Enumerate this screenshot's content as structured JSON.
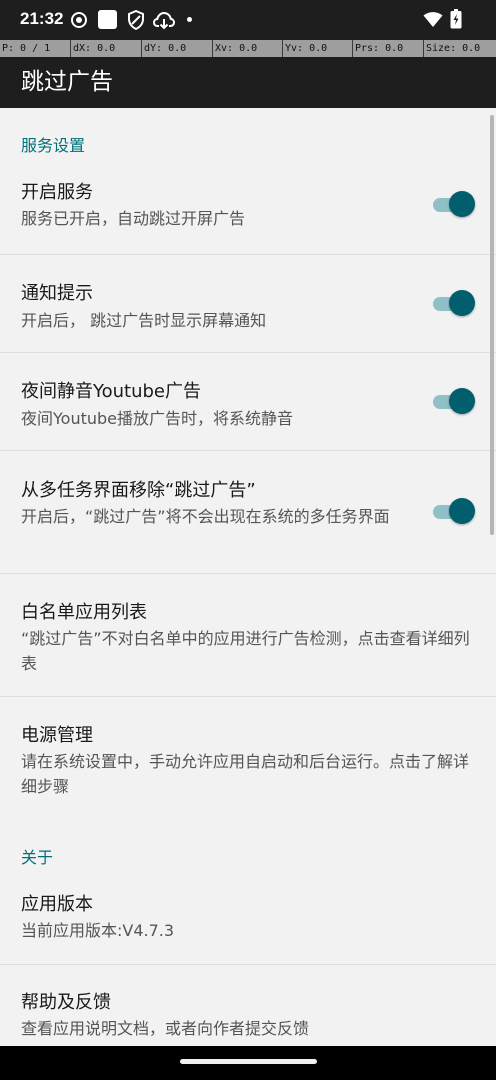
{
  "status_bar": {
    "time": "21:32",
    "icons": [
      "record-icon",
      "app-square-icon",
      "shield-icon",
      "cloud-download-icon",
      "dot-icon",
      "wifi-icon",
      "battery-charging-icon"
    ]
  },
  "pointer_overlay": [
    "P: 0 / 1",
    "dX: 0.0",
    "dY: 0.0",
    "Xv: 0.0",
    "Yv: 0.0",
    "Prs: 0.0",
    "Size: 0.0"
  ],
  "app_bar": {
    "title": "跳过广告"
  },
  "sections": {
    "service": "服务设置",
    "about": "关于"
  },
  "settings": {
    "enable_service": {
      "title": "开启服务",
      "summary": "服务已开启，自动跳过开屏广告",
      "checked": true
    },
    "notification": {
      "title": "通知提示",
      "summary": "开启后， 跳过广告时显示屏幕通知",
      "checked": true
    },
    "mute_youtube": {
      "title": "夜间静音Youtube广告",
      "summary": "夜间Youtube播放广告时，将系统静音",
      "checked": true
    },
    "hide_recents": {
      "title": "从多任务界面移除“跳过广告”",
      "summary": "开启后，“跳过广告”将不会出现在系统的多任务界面",
      "checked": true
    },
    "whitelist": {
      "title": "白名单应用列表",
      "summary": "“跳过广告”不对白名单中的应用进行广告检测，点击查看详细列表"
    },
    "power": {
      "title": "电源管理",
      "summary": "请在系统设置中，手动允许应用自启动和后台运行。点击了解详细步骤"
    },
    "version": {
      "title": "应用版本",
      "summary": "当前应用版本:V4.7.3"
    },
    "help": {
      "title": "帮助及反馈",
      "summary": "查看应用说明文档，或者向作者提交反馈"
    }
  },
  "colors": {
    "accent": "#005e6d",
    "category_text": "#00707a",
    "app_bar": "#1e1e1e",
    "background": "#f2f2f2"
  }
}
